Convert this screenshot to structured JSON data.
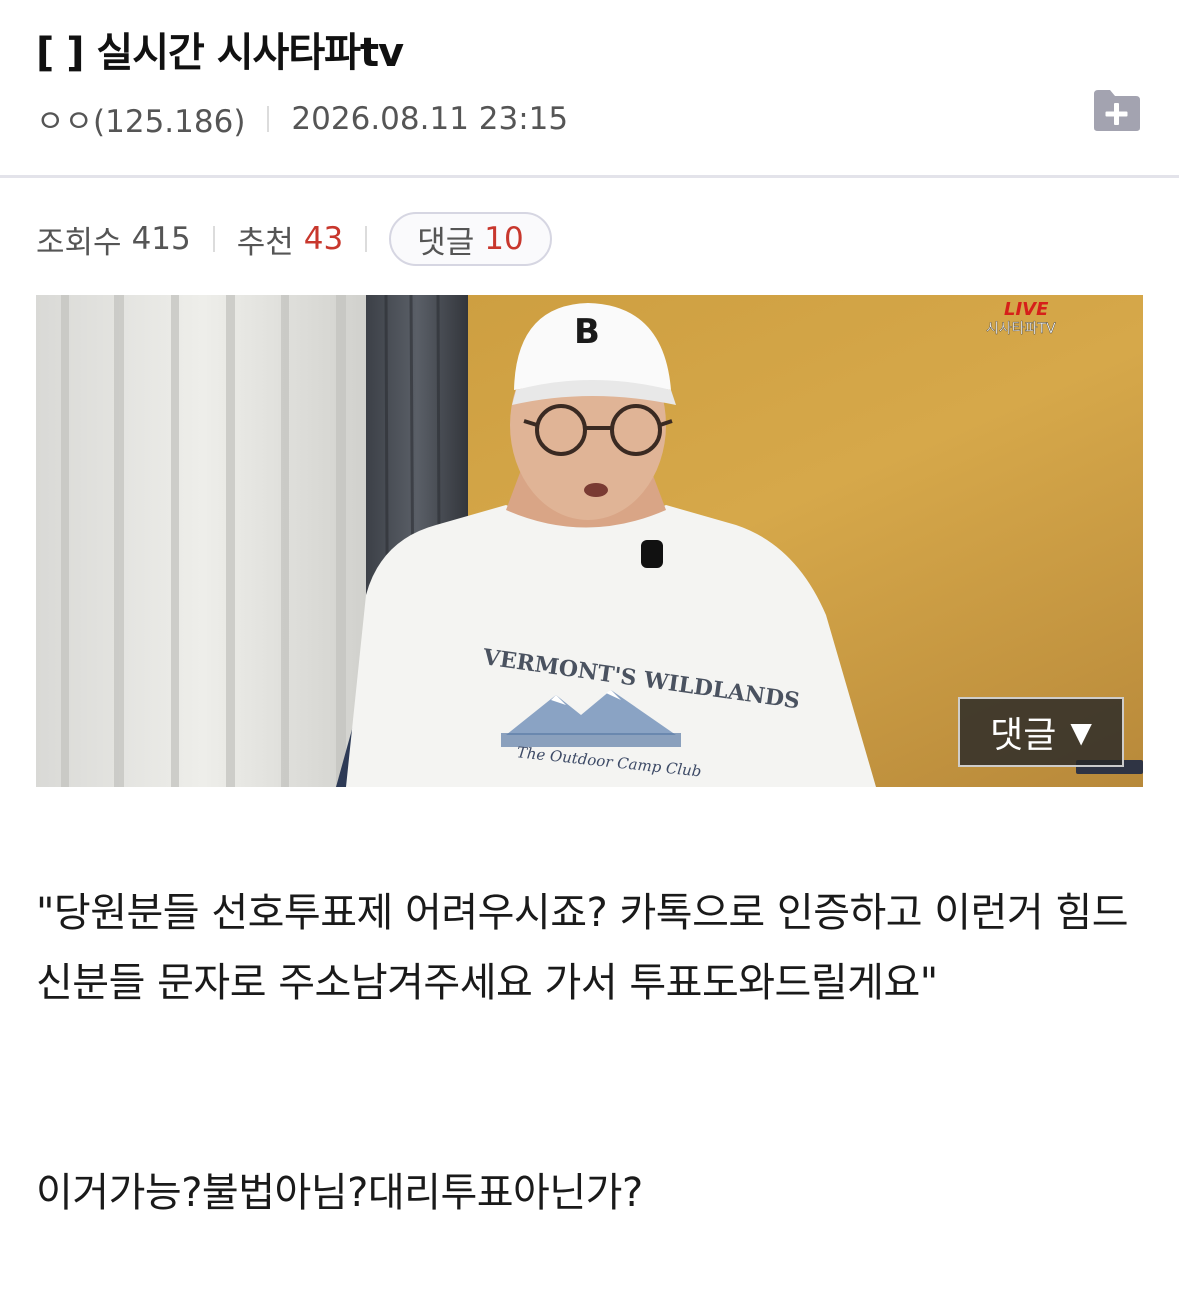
{
  "post": {
    "title": "[  ] 실시간 시사타파tv",
    "author": "ㅇㅇ(125.186)",
    "datetime": "2026.08.11 23:15",
    "folder_icon": "folder-plus-icon"
  },
  "stats": {
    "views_label": "조회수",
    "views_value": "415",
    "recommend_label": "추천",
    "recommend_value": "43",
    "comments_label": "댓글",
    "comments_value": "10",
    "accent_color": "#c8372d"
  },
  "video": {
    "live_badge": "LIVE",
    "channel_watermark": "시사타파TV",
    "tshirt_line1": "VERMONT'S WILDLANDS",
    "tshirt_line2": "The Outdoor Camp Club",
    "comment_button_label": "댓글",
    "comment_button_arrow": "▼"
  },
  "content": {
    "paragraph1": "\"당원분들 선호투표제 어려우시죠? 카톡으로 인증하고 이런거 힘드신분들 문자로 주소남겨주세요 가서 투표도와드릴게요\"",
    "paragraph2": "이거가능?불법아님?대리투표아닌가?"
  }
}
